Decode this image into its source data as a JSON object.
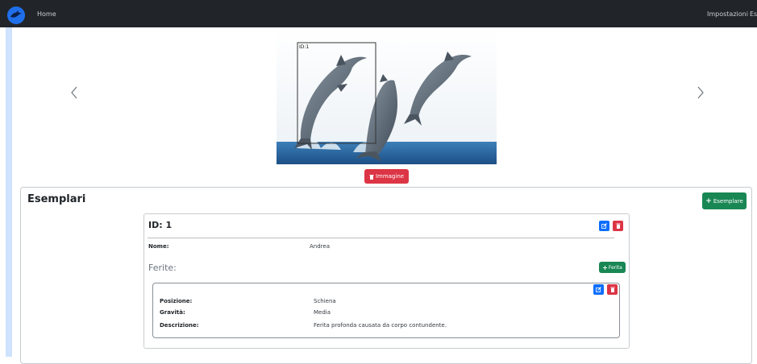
{
  "navbar": {
    "brand_icon": "dolphin-logo-icon",
    "home_label": "Home",
    "settings_label": "Impostazioni",
    "exit_label": "Esci"
  },
  "carousel": {
    "detection_label": "ID:1",
    "prev_icon": "chevron-left-icon",
    "next_icon": "chevron-right-icon"
  },
  "image_actions": {
    "delete_label": "Immagine"
  },
  "esemplari": {
    "title": "Esemplari",
    "add_label": "Esemplare",
    "specimen": {
      "title": "ID: 1",
      "name_label": "Nome:",
      "name_value": "Andrea",
      "wounds_title": "Ferite:",
      "add_wound_label": "Ferita",
      "wound": {
        "position_label": "Posizione:",
        "position_value": "Schiena",
        "severity_label": "Gravità:",
        "severity_value": "Media",
        "description_label": "Descrizione:",
        "description_value": "Ferita profonda causata da corpo contundente."
      }
    }
  },
  "colors": {
    "navbar": "#212529",
    "danger": "#dc3545",
    "success": "#198754",
    "primary": "#0d6efd",
    "sidebar": "#cfe2ff"
  }
}
